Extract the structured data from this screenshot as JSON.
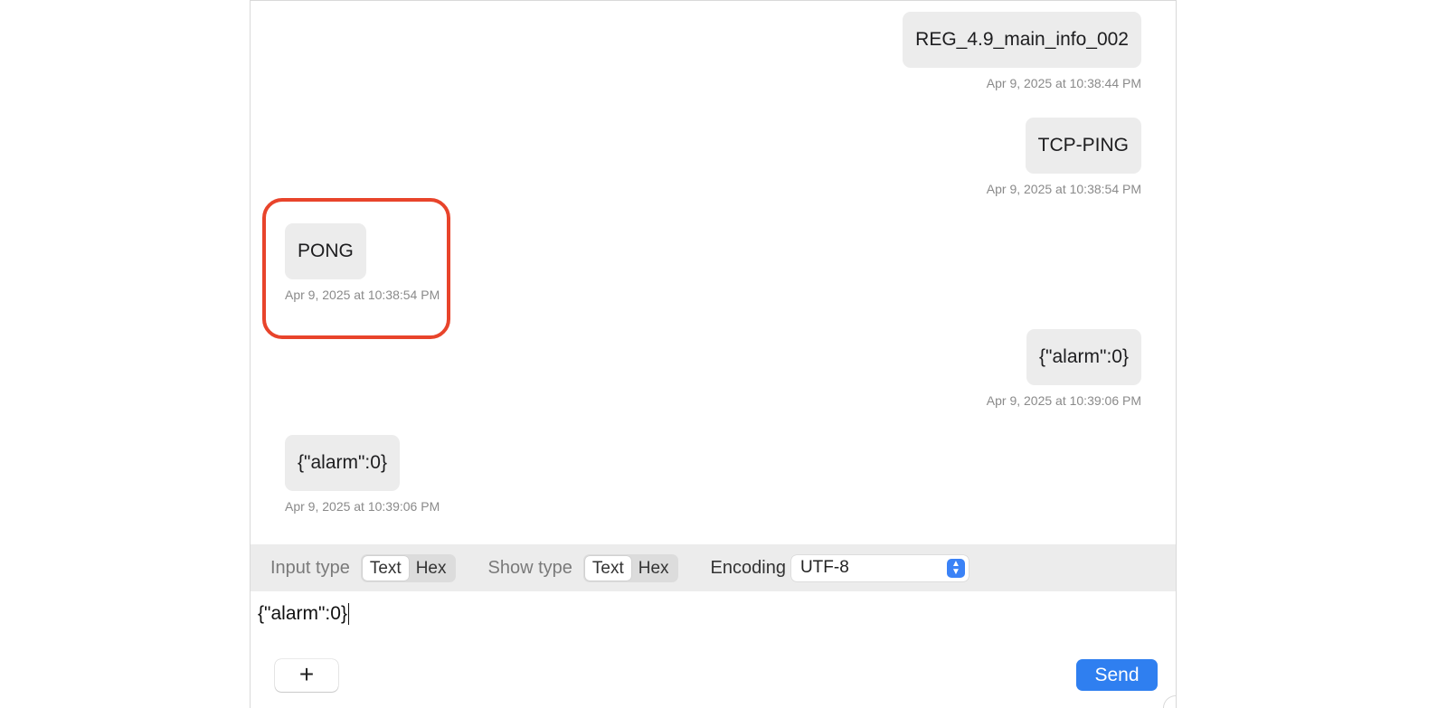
{
  "messages": [
    {
      "side": "right",
      "text": "REG_4.9_main_info_002",
      "time": "Apr 9, 2025 at 10:38:44 PM"
    },
    {
      "side": "right",
      "text": "TCP-PING",
      "time": "Apr 9, 2025 at 10:38:54 PM"
    },
    {
      "side": "left",
      "text": "PONG",
      "time": "Apr 9, 2025 at 10:38:54 PM"
    },
    {
      "side": "right",
      "text": "{\"alarm\":0}",
      "time": "Apr 9, 2025 at 10:39:06 PM"
    },
    {
      "side": "left",
      "text": "{\"alarm\":0}",
      "time": "Apr 9, 2025 at 10:39:06 PM"
    }
  ],
  "toolbar": {
    "input_type_label": "Input type",
    "show_type_label": "Show type",
    "encoding_label": "Encoding",
    "text_option": "Text",
    "hex_option": "Hex",
    "encoding_value": "UTF-8"
  },
  "input": {
    "value": "{\"alarm\":0}"
  },
  "buttons": {
    "add": "+",
    "send": "Send"
  },
  "colors": {
    "accent": "#2f7ff0",
    "highlight": "#e8442b",
    "bubble": "#ececec"
  }
}
